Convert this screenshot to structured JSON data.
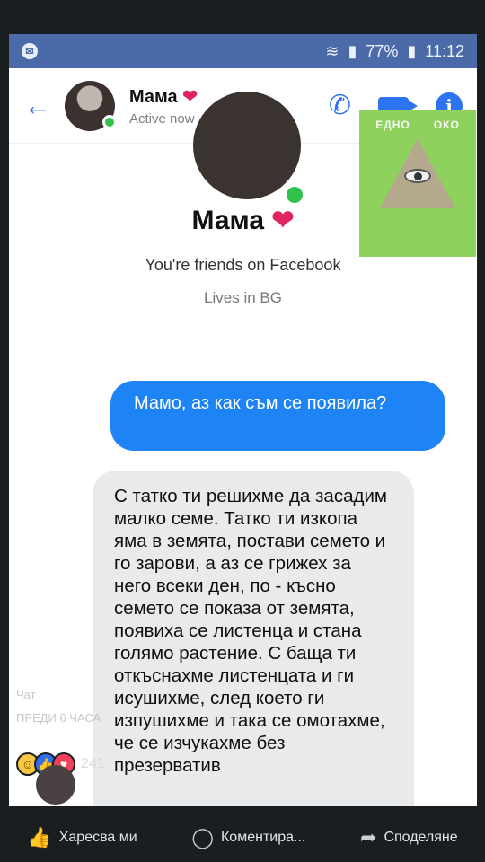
{
  "status_bar": {
    "battery": "77%",
    "time": "11:12"
  },
  "chat_header": {
    "name": "Мама",
    "status": "Active now"
  },
  "profile": {
    "name": "Мама",
    "friends_text": "You're friends on Facebook",
    "lives_text": "Lives in BG"
  },
  "watermark": {
    "left": "ЕДНО",
    "right": "ОКО"
  },
  "messages": [
    {
      "direction": "outgoing",
      "text": "Мамо, аз как съм се появила?"
    },
    {
      "direction": "incoming",
      "text": "С татко ти решихме да засадим малко семе. Татко ти изкопа яма в земята, постави семето и го зарови, а аз се грижех за него всеки ден, по - късно семето се показа от земята, появиха се листенца и стана голямо растение. С баща ти откъснахме листенцата и ги исушихме, след което ги изпушихме и така се омотахме, че се изчукахме без презерватив"
    }
  ],
  "feed": {
    "chat_label": "Чат",
    "time_label": "ПРЕДИ 6 ЧАСА",
    "reaction_count": "241",
    "actions": {
      "like": "Харесва ми",
      "comment": "Коментира...",
      "share": "Споделяне"
    }
  },
  "icons": {
    "back": "arrow-left-icon",
    "call": "phone-icon",
    "video": "video-camera-icon",
    "info": "info-icon"
  },
  "colors": {
    "messenger_blue": "#1e84f5",
    "status_bar": "#4a6ba8",
    "online_green": "#31c24d",
    "incoming_bubble": "#e9eaec"
  }
}
